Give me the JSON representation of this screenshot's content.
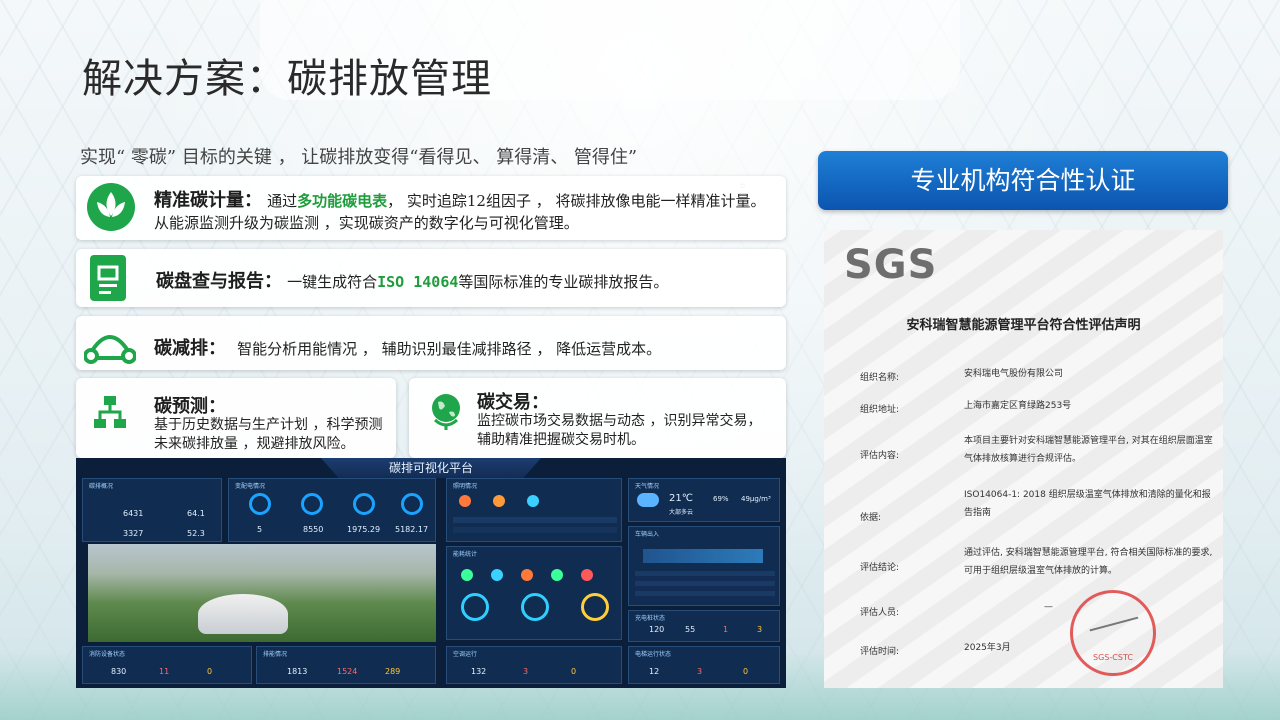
{
  "title": "解决方案：碳排放管理",
  "intro": "实现“ 零碳” 目标的关键 ， 让碳排放变得“看得见、 算得清、 管得住”",
  "intro_tail": "。",
  "cards": {
    "precise": {
      "heading": "精准碳计量：",
      "pre": "通过",
      "highlight": "多功能碳电表",
      "body": "， 实时追踪12组因子 ， 将碳排放像电能一样精准计量。 从能源监测升级为碳监测 ，实现碳资产的数字化与可视化管理。",
      "icon": "lotus-leaf-icon"
    },
    "report": {
      "heading": "碳盘查与报告：",
      "pre": "一键生成符合",
      "highlight": "ISO 14064",
      "body": "等国际标准的专业碳排放报告。",
      "icon": "document-icon"
    },
    "reduce": {
      "heading": "碳减排：",
      "body": "智能分析用能情况 ， 辅助识别最佳减排路径 ， 降低运营成本。",
      "icon": "hill-route-icon"
    },
    "forecast": {
      "heading": "碳预测：",
      "body": "基于历史数据与生产计划 ，科学预测未来碳排放量 ，规避排放风险。",
      "icon": "org-chart-icon"
    },
    "trade": {
      "heading": "碳交易：",
      "body": "监控碳市场交易数据与动态 ，识别异常交易， 辅助精准把握碳交易时机。",
      "icon": "globe-icon"
    }
  },
  "cert": {
    "header": "专业机构符合性认证",
    "logo": "SGS",
    "doc_title": "安科瑞智慧能源管理平台符合性评估声明",
    "rows": [
      {
        "label": "组织名称:",
        "value": "安科瑞电气股份有限公司"
      },
      {
        "label": "组织地址:",
        "value": "上海市嘉定区育绿路253号"
      },
      {
        "label": "评估内容:",
        "value": "本项目主要针对安科瑞智慧能源管理平台, 对其在组织层面温室气体排放核算进行合规评估。"
      },
      {
        "label": "依据:",
        "value": "ISO14064-1: 2018 组织层级温室气体排放和清除的量化和报告指南"
      },
      {
        "label": "评估结论:",
        "value": "通过评估, 安科瑞智慧能源管理平台, 符合相关国际标准的要求, 可用于组织层级温室气体排放的计算。"
      },
      {
        "label": "评估人员:",
        "value": "—"
      },
      {
        "label": "评估时间:",
        "value": "2025年3月"
      }
    ],
    "stamp_text": "SGS-CSTC"
  },
  "dashboard": {
    "title": "碳排可视化平台",
    "panels": {
      "overview": "碳排概况",
      "power": "变配电情况",
      "lighting": "照明情况",
      "weather": "天气情况",
      "energy": "能耗统计",
      "vehicle": "车辆出入",
      "charging": "充电桩状态",
      "fire": "消防设备状态",
      "sewage": "排能情况",
      "ac": "空调运行",
      "elevator": "电梯运行状态"
    },
    "overview_values": [
      "6431",
      "64.1",
      "3327",
      "52.3"
    ],
    "power_values": [
      "5",
      "8550",
      "1975.29",
      "5182.17"
    ],
    "weather": {
      "temp": "21℃",
      "desc": "大部多云",
      "humidity": "69%",
      "pm": "49μg/m³"
    },
    "charging_values": [
      "120",
      "55",
      "1",
      "3"
    ],
    "fire_values": [
      "830",
      "11",
      "0"
    ],
    "sewage_values": [
      "1813",
      "1524",
      "289"
    ],
    "ac_values": [
      "132",
      "3",
      "0"
    ],
    "elevator_values": [
      "12",
      "3",
      "0"
    ]
  }
}
